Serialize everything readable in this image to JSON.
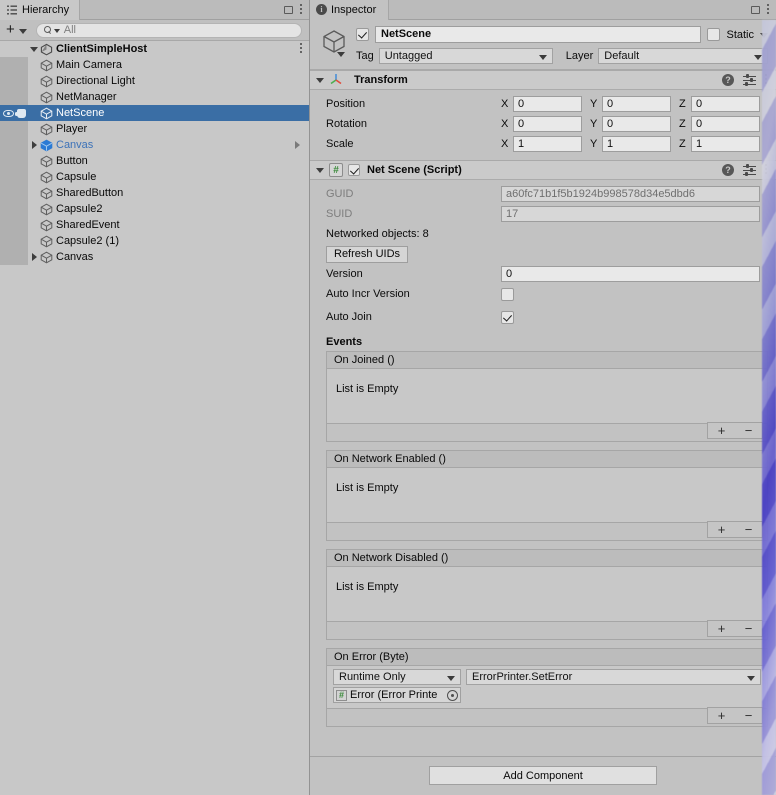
{
  "hierarchy": {
    "tab_label": "Hierarchy",
    "tab_icon": "hierarchy-icon",
    "toolbar": {
      "add_label": "+",
      "search_placeholder": "All",
      "search_value": ""
    },
    "scene": {
      "name": "ClientSimpleHost",
      "icon": "unity-scene-icon",
      "expanded": true
    },
    "items": [
      {
        "label": "Main Camera",
        "icon": "gameobject-cube-icon",
        "type": "gameobject",
        "indent": 2,
        "expandable": false,
        "selected": false
      },
      {
        "label": "Directional Light",
        "icon": "gameobject-cube-icon",
        "type": "gameobject",
        "indent": 2,
        "expandable": false,
        "selected": false
      },
      {
        "label": "NetManager",
        "icon": "gameobject-cube-icon",
        "type": "gameobject",
        "indent": 2,
        "expandable": false,
        "selected": false
      },
      {
        "label": "NetScene",
        "icon": "gameobject-cube-icon",
        "type": "gameobject",
        "indent": 2,
        "expandable": false,
        "selected": true
      },
      {
        "label": "Player",
        "icon": "gameobject-cube-icon",
        "type": "gameobject",
        "indent": 2,
        "expandable": false,
        "selected": false
      },
      {
        "label": "Canvas",
        "icon": "prefab-cube-icon",
        "type": "prefab",
        "indent": 2,
        "expandable": true,
        "selected": false,
        "has_open_arrow": true
      },
      {
        "label": "Button",
        "icon": "gameobject-cube-icon",
        "type": "gameobject",
        "indent": 2,
        "expandable": false,
        "selected": false
      },
      {
        "label": "Capsule",
        "icon": "gameobject-cube-icon",
        "type": "gameobject",
        "indent": 2,
        "expandable": false,
        "selected": false
      },
      {
        "label": "SharedButton",
        "icon": "gameobject-cube-icon",
        "type": "gameobject",
        "indent": 2,
        "expandable": false,
        "selected": false
      },
      {
        "label": "Capsule2",
        "icon": "gameobject-cube-icon",
        "type": "gameobject",
        "indent": 2,
        "expandable": false,
        "selected": false
      },
      {
        "label": "SharedEvent",
        "icon": "gameobject-cube-icon",
        "type": "gameobject",
        "indent": 2,
        "expandable": false,
        "selected": false
      },
      {
        "label": "Capsule2 (1)",
        "icon": "gameobject-cube-icon",
        "type": "gameobject",
        "indent": 2,
        "expandable": false,
        "selected": false
      },
      {
        "label": "Canvas",
        "icon": "gameobject-cube-icon",
        "type": "gameobject",
        "indent": 2,
        "expandable": true,
        "selected": false
      }
    ]
  },
  "inspector": {
    "tab_label": "Inspector",
    "tab_icon": "info-icon",
    "lock_icon": "lock-icon",
    "menu_icon": "kebab-menu-icon",
    "gameobject": {
      "enabled": true,
      "name": "NetScene",
      "static_label": "Static",
      "static_checked": false,
      "tag_label": "Tag",
      "tag_value": "Untagged",
      "layer_label": "Layer",
      "layer_value": "Default"
    },
    "transform": {
      "title": "Transform",
      "icon": "transform-axis-icon",
      "expanded": true,
      "rows": [
        {
          "label": "Position",
          "x": "0",
          "y": "0",
          "z": "0"
        },
        {
          "label": "Rotation",
          "x": "0",
          "y": "0",
          "z": "0"
        },
        {
          "label": "Scale",
          "x": "1",
          "y": "1",
          "z": "1"
        }
      ],
      "axis_labels": [
        "X",
        "Y",
        "Z"
      ]
    },
    "net_scene": {
      "title": "Net Scene (Script)",
      "icon": "csharp-script-icon",
      "enabled": true,
      "expanded": true,
      "guid_label": "GUID",
      "guid_value": "a60fc71b1f5b1924b998578d34e5dbd6",
      "suid_label": "SUID",
      "suid_value": "17",
      "networked_objects_label": "Networked objects: 8",
      "refresh_button": "Refresh UIDs",
      "version_label": "Version",
      "version_value": "0",
      "auto_incr_label": "Auto Incr Version",
      "auto_incr_checked": false,
      "auto_join_label": "Auto Join",
      "auto_join_checked": true,
      "events_title": "Events",
      "events": [
        {
          "title": "On Joined ()",
          "empty_text": "List is Empty",
          "entries": [],
          "add_label": "+",
          "remove_label": "−"
        },
        {
          "title": "On Network Enabled ()",
          "empty_text": "List is Empty",
          "entries": [],
          "add_label": "+",
          "remove_label": "−"
        },
        {
          "title": "On Network Disabled ()",
          "empty_text": "List is Empty",
          "entries": [],
          "add_label": "+",
          "remove_label": "−"
        },
        {
          "title": "On Error (Byte)",
          "empty_text": "",
          "entries": [
            {
              "mode": "Runtime Only",
              "method": "ErrorPrinter.SetError",
              "object_name": "Error (Error Printe",
              "object_icon": "csharp-script-icon",
              "picker_icon": "object-picker-icon"
            }
          ],
          "add_label": "+",
          "remove_label": "−"
        }
      ]
    },
    "add_component_label": "Add Component"
  },
  "colors": {
    "selection_blue": "#3a6ea5",
    "prefab_blue": "#3c72b8",
    "panel_bg": "#c2c2c2",
    "hierarchy_bg": "#c8c8c8"
  }
}
